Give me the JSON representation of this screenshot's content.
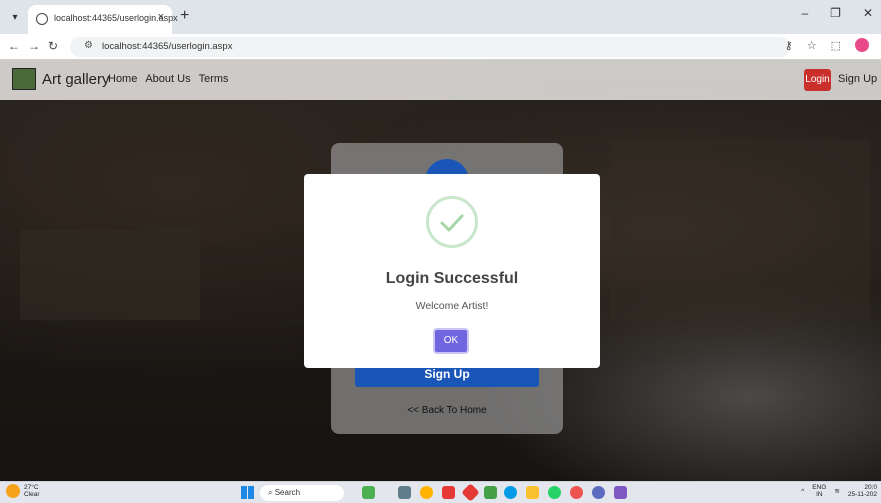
{
  "browser": {
    "tab_title": "localhost:44365/userlogin.aspx",
    "url": "localhost:44365/userlogin.aspx"
  },
  "navbar": {
    "brand": "Art gallery",
    "links": [
      "Home",
      "About Us",
      "Terms"
    ],
    "login_label": "Login",
    "signup_label": "Sign Up"
  },
  "card": {
    "signup_label": "Sign Up",
    "back_label": "<< Back To Home"
  },
  "modal": {
    "title": "Login Successful",
    "message": "Welcome Artist!",
    "ok_label": "OK"
  },
  "taskbar": {
    "temperature": "27°C",
    "weather": "Clear",
    "search_placeholder": "Search",
    "language": "ENG",
    "region": "IN",
    "time": "20:0",
    "date": "25-11-202"
  },
  "colors": {
    "ok_button": "#7066e0",
    "signup_button": "#1a55b8",
    "login_button": "#c9302c",
    "success": "#a5d6a7"
  }
}
